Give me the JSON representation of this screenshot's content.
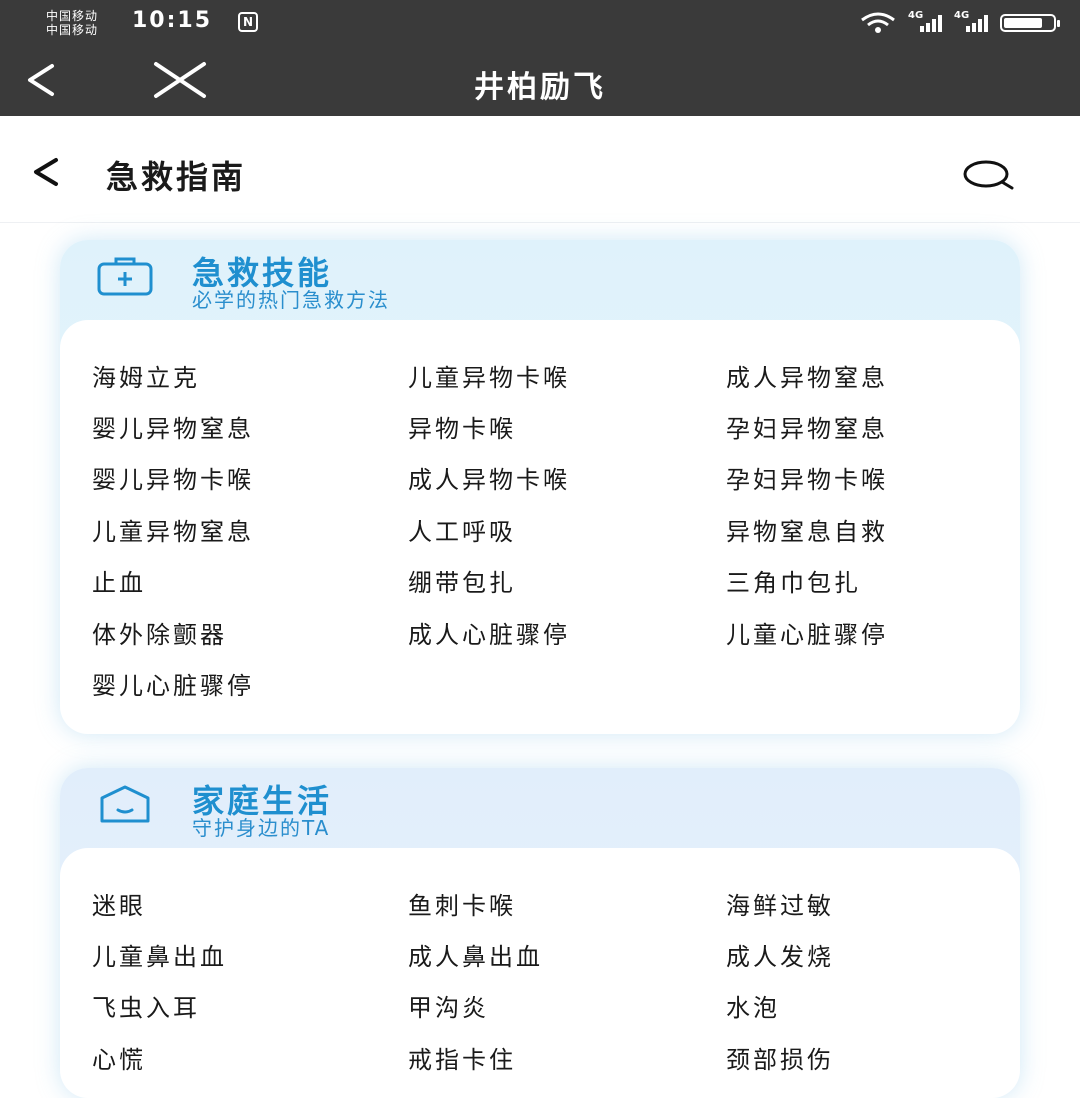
{
  "status_bar": {
    "carrier_1": "中国移动",
    "carrier_2": "中国移动",
    "time": "10:15",
    "nfc": "N",
    "network_1": "4G",
    "network_2": "4G"
  },
  "app_bar": {
    "title": "井柏励飞",
    "back_icon": "chevron-left-icon",
    "close_icon": "close-icon"
  },
  "page_header": {
    "title": "急救指南",
    "back_icon": "chevron-left-icon",
    "search_icon": "search-icon"
  },
  "sections": [
    {
      "title": "急救技能",
      "subtitle": "必学的热门急救方法",
      "icon": "first-aid-kit-icon",
      "items": [
        "海姆立克",
        "儿童异物卡喉",
        "成人异物窒息",
        "婴儿异物窒息",
        "异物卡喉",
        "孕妇异物窒息",
        "婴儿异物卡喉",
        "成人异物卡喉",
        "孕妇异物卡喉",
        "儿童异物窒息",
        "人工呼吸",
        "异物窒息自救",
        "止血",
        "绷带包扎",
        "三角巾包扎",
        "体外除颤器",
        "成人心脏骤停",
        "儿童心脏骤停",
        "婴儿心脏骤停"
      ]
    },
    {
      "title": "家庭生活",
      "subtitle": "守护身边的TA",
      "icon": "home-icon",
      "items": [
        "迷眼",
        "鱼刺卡喉",
        "海鲜过敏",
        "儿童鼻出血",
        "成人鼻出血",
        "成人发烧",
        "飞虫入耳",
        "甲沟炎",
        "水泡",
        "心慌",
        "戒指卡住",
        "颈部损伤"
      ]
    }
  ],
  "colors": {
    "status_bar_bg": "#3a3a3a",
    "accent": "#1f8fcf",
    "card_bg": "#dff2fb"
  }
}
